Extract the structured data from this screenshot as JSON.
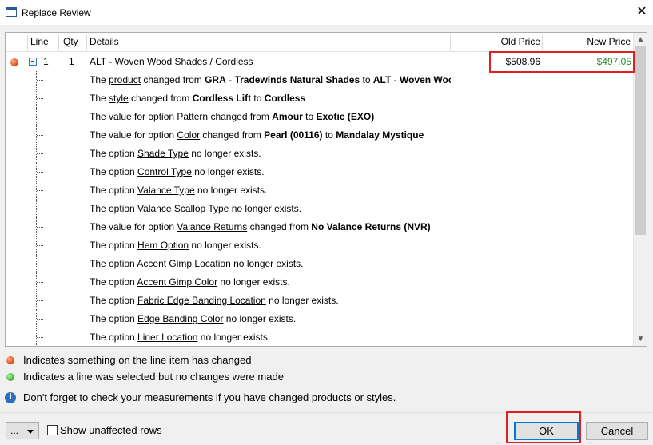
{
  "window": {
    "title": "Replace Review",
    "close_glyph": "✕"
  },
  "grid": {
    "columns": [
      "Line",
      "Qty",
      "Details",
      "Old Price",
      "New Price"
    ],
    "main_row": {
      "status": "changed",
      "line": "1",
      "qty": "1",
      "details": "ALT - Woven Wood Shades / Cordless",
      "old_price": "$508.96",
      "new_price": "$497.05",
      "new_price_color": "#2a8c2a"
    },
    "changes": [
      [
        {
          "t": "The "
        },
        {
          "t": "product",
          "u": true
        },
        {
          "t": " changed from "
        },
        {
          "t": "GRA",
          "b": true
        },
        {
          "t": " - "
        },
        {
          "t": "Tradewinds Natural Shades",
          "b": true
        },
        {
          "t": " to "
        },
        {
          "t": "ALT",
          "b": true
        },
        {
          "t": " - "
        },
        {
          "t": "Woven Wood Shades",
          "b": true
        }
      ],
      [
        {
          "t": "The "
        },
        {
          "t": "style",
          "u": true
        },
        {
          "t": " changed from "
        },
        {
          "t": "Cordless Lift",
          "b": true
        },
        {
          "t": " to "
        },
        {
          "t": "Cordless",
          "b": true
        }
      ],
      [
        {
          "t": "The value for option "
        },
        {
          "t": "Pattern",
          "u": true
        },
        {
          "t": " changed from "
        },
        {
          "t": "Amour",
          "b": true
        },
        {
          "t": " to "
        },
        {
          "t": "Exotic (EXO)",
          "b": true
        }
      ],
      [
        {
          "t": "The value for option "
        },
        {
          "t": "Color",
          "u": true
        },
        {
          "t": " changed from "
        },
        {
          "t": "Pearl (00116)",
          "b": true
        },
        {
          "t": " to "
        },
        {
          "t": "Mandalay Mystique",
          "b": true
        }
      ],
      [
        {
          "t": "The option "
        },
        {
          "t": "Shade Type",
          "u": true
        },
        {
          "t": " no longer exists."
        }
      ],
      [
        {
          "t": "The option "
        },
        {
          "t": "Control Type",
          "u": true
        },
        {
          "t": " no longer exists."
        }
      ],
      [
        {
          "t": "The option "
        },
        {
          "t": "Valance Type",
          "u": true
        },
        {
          "t": " no longer exists."
        }
      ],
      [
        {
          "t": "The option "
        },
        {
          "t": "Valance Scallop Type",
          "u": true
        },
        {
          "t": " no longer exists."
        }
      ],
      [
        {
          "t": "The value for option "
        },
        {
          "t": "Valance Returns",
          "u": true
        },
        {
          "t": " changed from "
        },
        {
          "t": "No Valance Returns (NVR)",
          "b": true
        }
      ],
      [
        {
          "t": "The option "
        },
        {
          "t": "Hem Option",
          "u": true
        },
        {
          "t": " no longer exists."
        }
      ],
      [
        {
          "t": "The option "
        },
        {
          "t": "Accent Gimp Location",
          "u": true
        },
        {
          "t": " no longer exists."
        }
      ],
      [
        {
          "t": "The option "
        },
        {
          "t": "Accent Gimp Color",
          "u": true
        },
        {
          "t": " no longer exists."
        }
      ],
      [
        {
          "t": "The option "
        },
        {
          "t": "Fabric Edge Banding Location",
          "u": true
        },
        {
          "t": " no longer exists."
        }
      ],
      [
        {
          "t": "The option "
        },
        {
          "t": "Edge Banding Color",
          "u": true
        },
        {
          "t": " no longer exists."
        }
      ],
      [
        {
          "t": "The option "
        },
        {
          "t": "Liner Location",
          "u": true
        },
        {
          "t": " no longer exists."
        }
      ]
    ]
  },
  "legend": {
    "changed": {
      "text": "Indicates something on the line item has changed",
      "color": "#e2501a"
    },
    "unchanged": {
      "text": "Indicates a line was selected but no changes were made",
      "color": "#3cb43c"
    },
    "info": {
      "text": "Don't forget to check your measurements if you have changed products or styles."
    }
  },
  "footer": {
    "menu_label": "...",
    "show_unaffected_label": "Show unaffected rows",
    "show_unaffected_checked": false,
    "ok_label": "OK",
    "cancel_label": "Cancel"
  }
}
